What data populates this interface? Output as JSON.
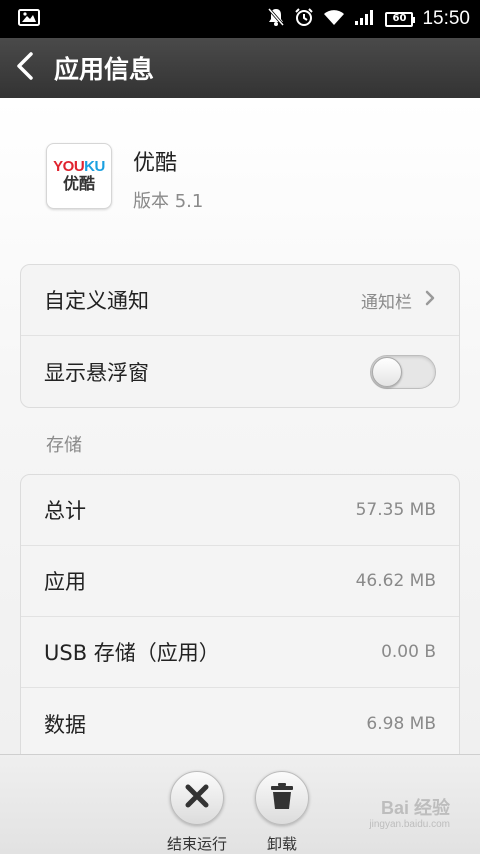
{
  "status_bar": {
    "time": "15:50",
    "battery": "60",
    "icons": [
      "image-icon",
      "notification-off-icon",
      "alarm-icon",
      "wifi-icon",
      "signal-icon",
      "battery-icon"
    ]
  },
  "action_bar": {
    "title": "应用信息",
    "back_icon": "back-arrow-icon"
  },
  "app": {
    "name": "优酷",
    "version": "版本 5.1",
    "logo_text_top_a": "YOU",
    "logo_text_top_b": "KU",
    "logo_text_bottom": "优酷"
  },
  "settings": {
    "notification_label": "自定义通知",
    "notification_value": "通知栏",
    "floating_label": "显示悬浮窗",
    "floating_enabled": false
  },
  "storage": {
    "section_label": "存储",
    "rows": [
      {
        "label": "总计",
        "value": "57.35 MB"
      },
      {
        "label": "应用",
        "value": "46.62 MB"
      },
      {
        "label": "USB 存储（应用）",
        "value": "0.00 B"
      },
      {
        "label": "数据",
        "value": "6.98 MB"
      }
    ]
  },
  "bottom_actions": {
    "force_stop_label": "结束运行",
    "uninstall_label": "卸载"
  },
  "watermark": {
    "main": "Bai 经验",
    "sub": "jingyan.baidu.com"
  },
  "colors": {
    "action_bar": "#3d3d3d",
    "status_bar": "#000000",
    "accent_red": "#e0242f",
    "accent_blue": "#1aa0e0"
  }
}
